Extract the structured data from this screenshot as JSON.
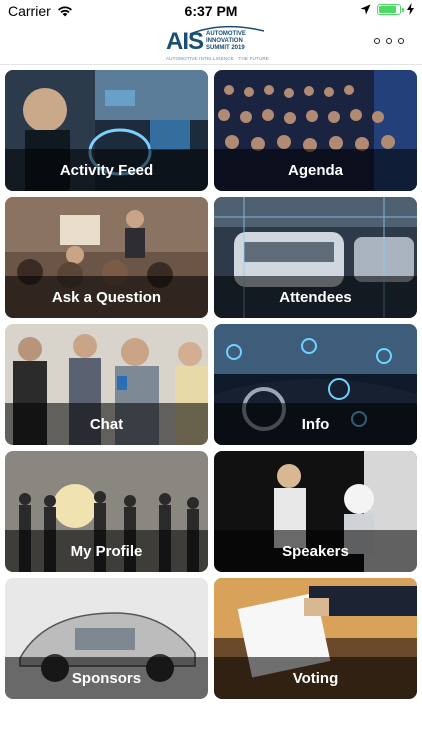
{
  "status": {
    "carrier": "Carrier",
    "time": "6:37 PM",
    "battery_level": 0.9,
    "icons": [
      "wifi-icon",
      "location-arrow-icon",
      "battery-icon",
      "charging-icon"
    ]
  },
  "header": {
    "logo_mark": "AIS",
    "logo_lines": [
      "AUTOMOTIVE",
      "INNOVATION",
      "SUMMIT 2019"
    ],
    "logo_tagline": "AUTOMOTIVE INTELLIGENCE · THE FUTURE",
    "menu_icon": "more-horizontal-icon"
  },
  "tiles": [
    {
      "label": "Activity Feed",
      "scene": "dashboard"
    },
    {
      "label": "Agenda",
      "scene": "audience"
    },
    {
      "label": "Ask a Question",
      "scene": "conference"
    },
    {
      "label": "Attendees",
      "scene": "factory"
    },
    {
      "label": "Chat",
      "scene": "people"
    },
    {
      "label": "Info",
      "scene": "car-interior"
    },
    {
      "label": "My Profile",
      "scene": "silhouettes"
    },
    {
      "label": "Speakers",
      "scene": "speaker"
    },
    {
      "label": "Sponsors",
      "scene": "car-cutaway"
    },
    {
      "label": "Voting",
      "scene": "ballot"
    }
  ],
  "colors": {
    "brand": "#1a4e73",
    "battery": "#4cd964"
  }
}
